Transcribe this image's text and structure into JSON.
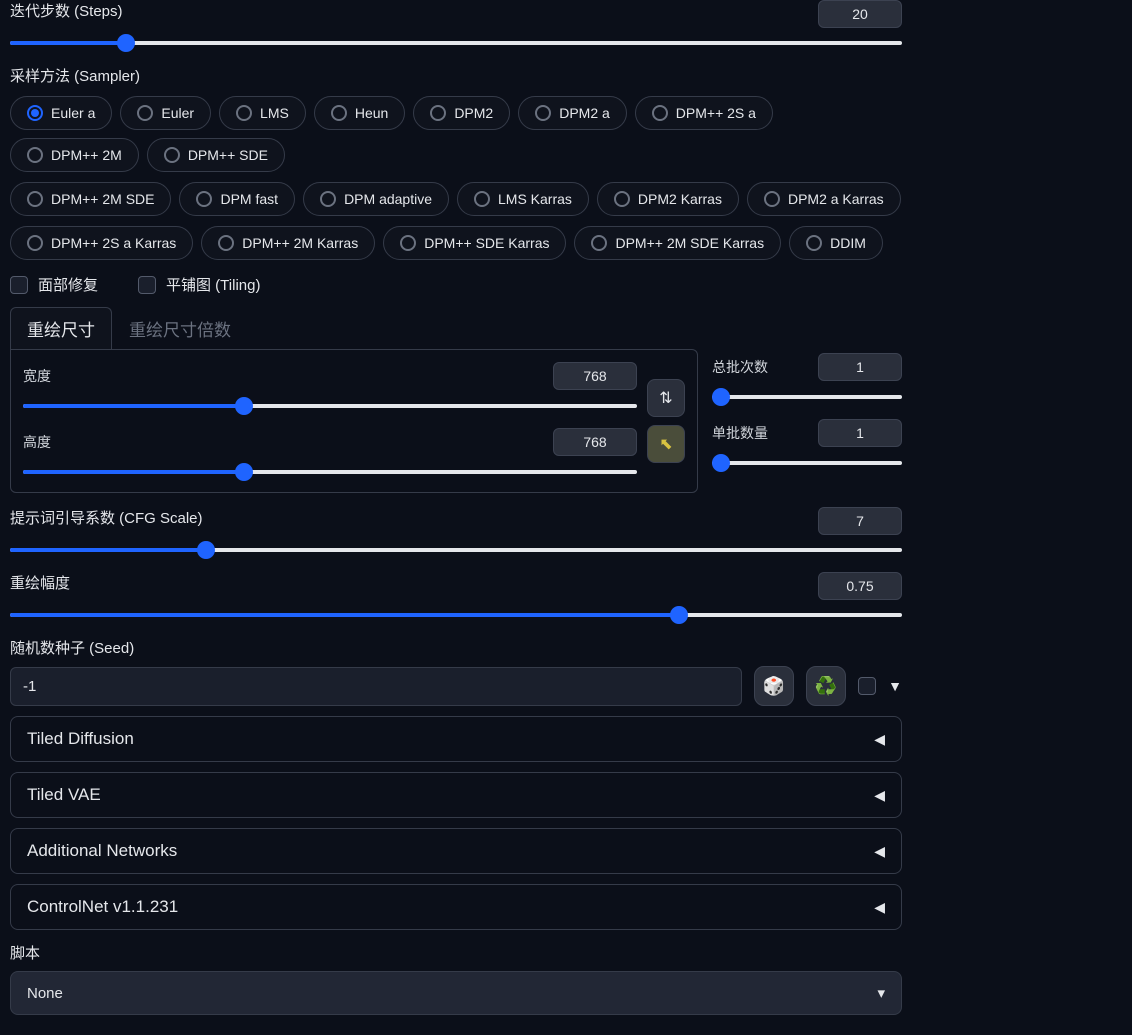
{
  "steps": {
    "label": "迭代步数 (Steps)",
    "value": "20",
    "fill_pct": 13
  },
  "sampler": {
    "label": "采样方法 (Sampler)",
    "selected": "Euler a",
    "row1": [
      "Euler a",
      "Euler",
      "LMS",
      "Heun",
      "DPM2",
      "DPM2 a",
      "DPM++ 2S a",
      "DPM++ 2M",
      "DPM++ SDE"
    ],
    "row2": [
      "DPM++ 2M SDE",
      "DPM fast",
      "DPM adaptive",
      "LMS Karras",
      "DPM2 Karras",
      "DPM2 a Karras"
    ],
    "row3": [
      "DPM++ 2S a Karras",
      "DPM++ 2M Karras",
      "DPM++ SDE Karras",
      "DPM++ 2M SDE Karras",
      "DDIM"
    ]
  },
  "checks": {
    "restore_faces": "面部修复",
    "tiling": "平铺图 (Tiling)"
  },
  "tabs": {
    "resize": "重绘尺寸",
    "resize_mult": "重绘尺寸倍数"
  },
  "size": {
    "width_label": "宽度",
    "width_value": "768",
    "width_fill_pct": 36,
    "height_label": "高度",
    "height_value": "768",
    "height_fill_pct": 36
  },
  "batch": {
    "count_label": "总批次数",
    "count_value": "1",
    "size_label": "单批数量",
    "size_value": "1"
  },
  "cfg": {
    "label": "提示词引导系数 (CFG Scale)",
    "value": "7",
    "fill_pct": 22
  },
  "denoise": {
    "label": "重绘幅度",
    "value": "0.75",
    "fill_pct": 75
  },
  "seed": {
    "label": "随机数种子 (Seed)",
    "value": "-1"
  },
  "icons": {
    "dice": "🎲",
    "recycle": "♻️",
    "swap": "⇅",
    "cursor": "↖"
  },
  "accordions": {
    "tiled_diffusion": "Tiled Diffusion",
    "tiled_vae": "Tiled VAE",
    "additional_networks": "Additional Networks",
    "controlnet": "ControlNet v1.1.231"
  },
  "script": {
    "label": "脚本",
    "selected": "None"
  }
}
